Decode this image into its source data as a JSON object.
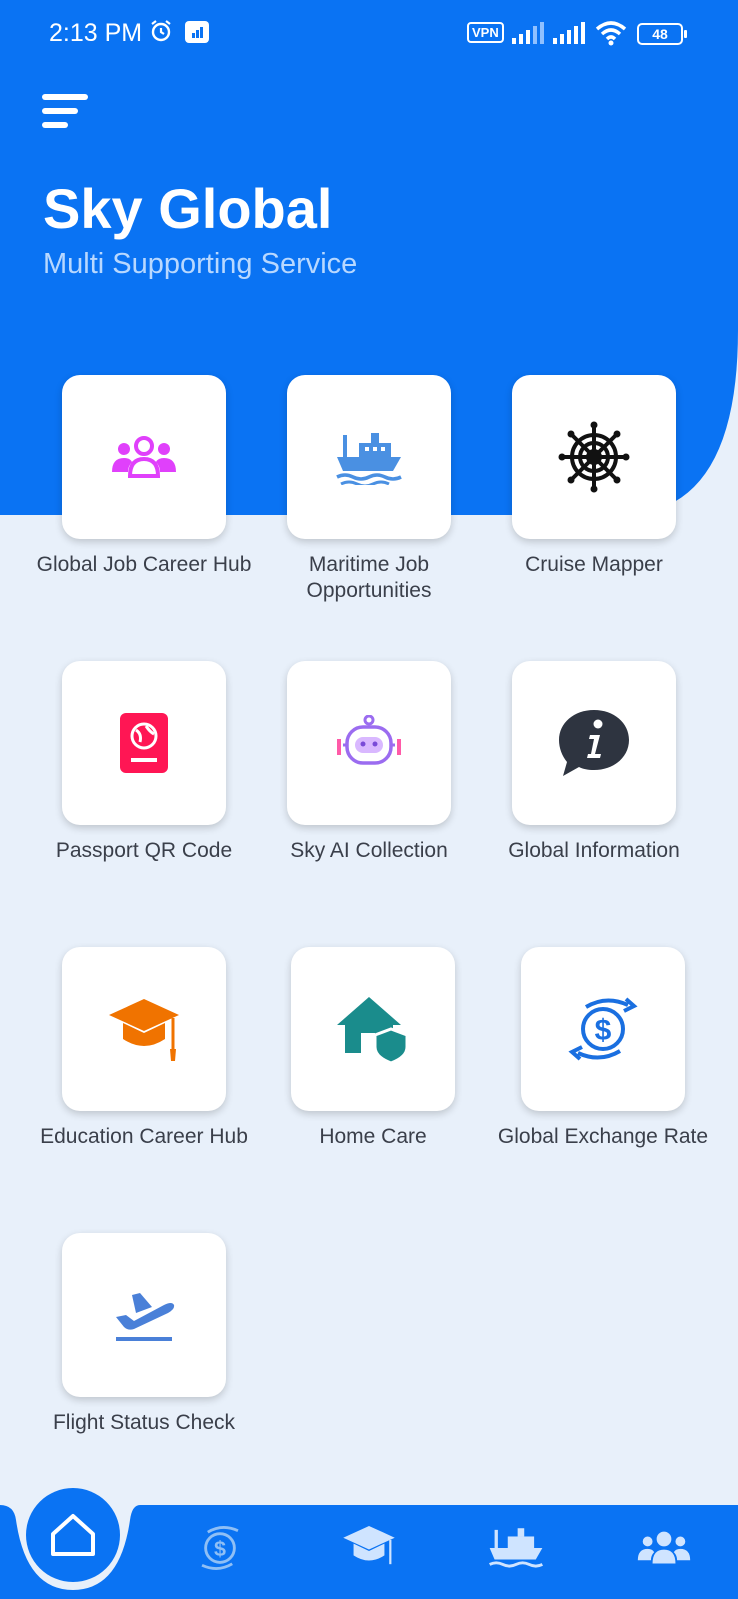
{
  "status_bar": {
    "time": "2:13 PM",
    "vpn": "VPN",
    "battery": "48"
  },
  "header": {
    "title": "Sky Global",
    "subtitle": "Multi Supporting Service"
  },
  "tiles": [
    {
      "label": "Global Job Career Hub",
      "icon": "people-group-icon",
      "color": "#e040fb"
    },
    {
      "label": "Maritime Job Opportunities",
      "icon": "ship-icon",
      "color": "#4a90e2"
    },
    {
      "label": "Cruise Mapper",
      "icon": "ship-wheel-icon",
      "color": "#111111"
    },
    {
      "label": "Passport QR Code",
      "icon": "passport-icon",
      "color": "#ff1654"
    },
    {
      "label": "Sky AI Collection",
      "icon": "robot-icon",
      "color": "#b46cf0"
    },
    {
      "label": "Global Information",
      "icon": "info-bubble-icon",
      "color": "#2e3440"
    },
    {
      "label": "Education Career Hub",
      "icon": "graduation-cap-icon",
      "color": "#f07300"
    },
    {
      "label": "Home Care",
      "icon": "home-shield-icon",
      "color": "#1a8c8c"
    },
    {
      "label": "Global Exchange Rate",
      "icon": "currency-exchange-icon",
      "color": "#1a6fe0"
    },
    {
      "label": "Flight Status Check",
      "icon": "plane-departure-icon",
      "color": "#4a80d8"
    }
  ],
  "bottom_nav": [
    {
      "name": "home",
      "icon": "home-icon"
    },
    {
      "name": "exchange",
      "icon": "currency-exchange-icon"
    },
    {
      "name": "education",
      "icon": "graduation-cap-icon"
    },
    {
      "name": "maritime",
      "icon": "ship-icon"
    },
    {
      "name": "jobs",
      "icon": "people-group-icon"
    }
  ]
}
